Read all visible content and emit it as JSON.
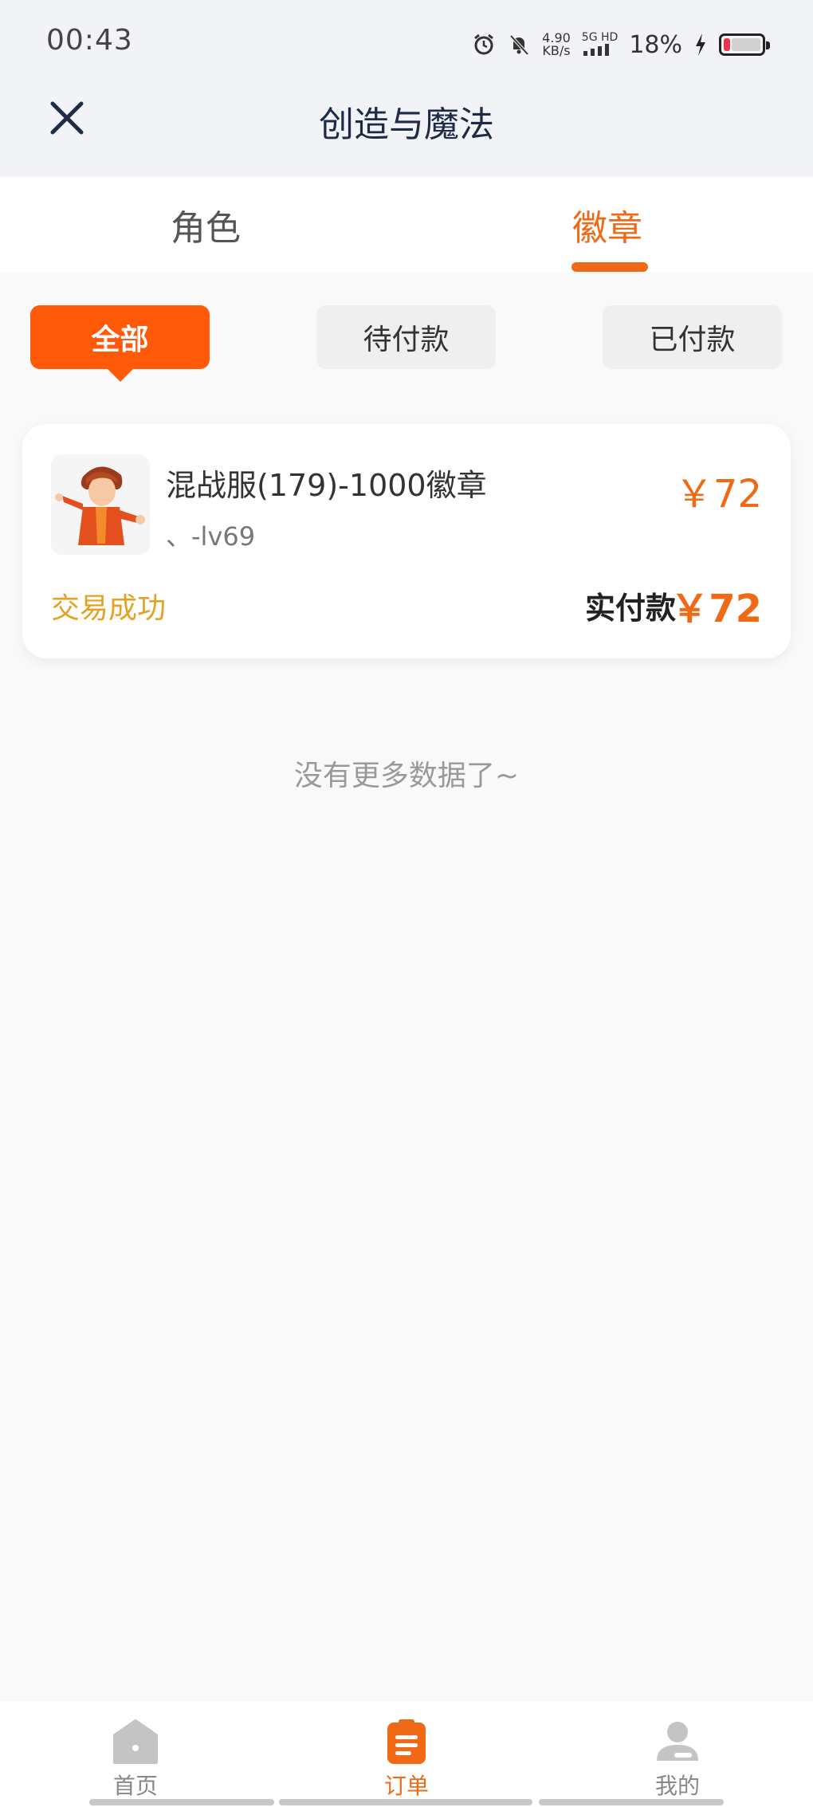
{
  "status_bar": {
    "time": "00:43",
    "speed_value": "4.90",
    "speed_unit": "KB/s",
    "network_label": "5G HD",
    "battery_percent": "18%",
    "battery_level": 0.18
  },
  "header": {
    "title": "创造与魔法"
  },
  "tabs": [
    {
      "label": "角色",
      "active": false
    },
    {
      "label": "徽章",
      "active": true
    }
  ],
  "filters": [
    {
      "label": "全部",
      "active": true
    },
    {
      "label": "待付款",
      "active": false
    },
    {
      "label": "已付款",
      "active": false
    }
  ],
  "order": {
    "title": "混战服(179)-1000徽章",
    "subtitle": "、-lv69",
    "price": "￥72",
    "status": "交易成功",
    "paid_label": "实付款",
    "paid_amount": "￥72"
  },
  "list_end": "没有更多数据了~",
  "bottom_nav": [
    {
      "label": "首页",
      "active": false
    },
    {
      "label": "订单",
      "active": true
    },
    {
      "label": "我的",
      "active": false
    }
  ],
  "colors": {
    "accent": "#f06a16",
    "filter_active": "#ff5a0a",
    "status_success": "#e3a224",
    "header_bg": "#f1f3f7"
  }
}
